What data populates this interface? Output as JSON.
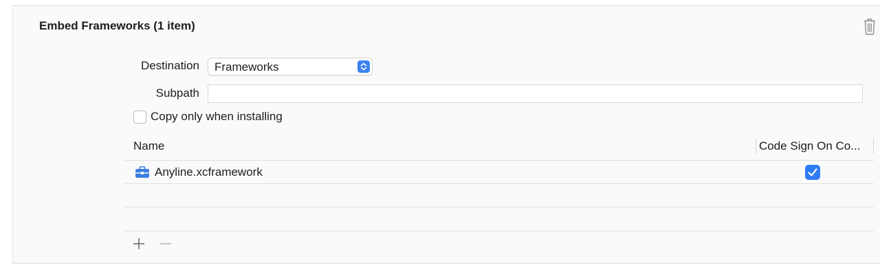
{
  "section": {
    "title": "Embed Frameworks (1 item)",
    "delete_icon": "trash-icon"
  },
  "form": {
    "destination_label": "Destination",
    "destination_value": "Frameworks",
    "subpath_label": "Subpath",
    "subpath_value": "",
    "copy_only_label": "Copy only when installing",
    "copy_only_checked": false
  },
  "table": {
    "columns": [
      "Name",
      "Code Sign On Co..."
    ],
    "rows": [
      {
        "name": "Anyline.xcframework",
        "icon": "framework-toolbox-icon",
        "code_sign": true
      }
    ]
  },
  "footer": {
    "add_icon": "plus-icon",
    "remove_icon": "minus-icon"
  },
  "colors": {
    "accent": "#3b82f0",
    "checkbox_checked": "#2f7bf5",
    "panel_bg": "#fafafa"
  }
}
